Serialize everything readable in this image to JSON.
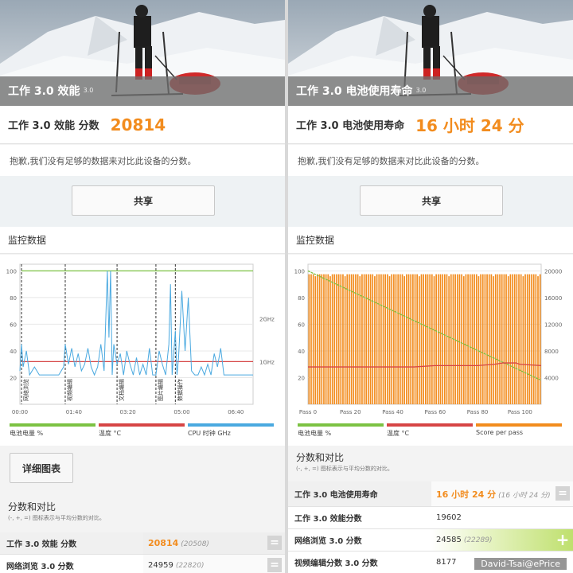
{
  "left": {
    "hero_title": "工作 3.0 效能",
    "hero_version": "3.0",
    "score_label": "工作 3.0 效能 分数",
    "score_value": "20814",
    "sorry_text": "抱歉,我们没有足够的数据来对比此设备的分数。",
    "share_label": "共享",
    "monitor_title": "监控数据",
    "detail_label": "详细图表",
    "compare_title": "分数和对比",
    "compare_note": "(-, +, =) 图标表示与平均分数的对比。",
    "legend": [
      {
        "label": "电池电量 %",
        "color": "#7cc243"
      },
      {
        "label": "温度 °C",
        "color": "#d64545"
      },
      {
        "label": "CPU 时钟 GHz",
        "color": "#4aa9e0"
      }
    ],
    "rows": [
      {
        "label": "工作 3.0 效能 分数",
        "value": "20814",
        "ref": "(20508)",
        "button": "="
      },
      {
        "label": "网络浏览 3.0 分数",
        "value": "24959",
        "ref": "(22820)",
        "button": "="
      }
    ]
  },
  "right": {
    "hero_title": "工作 3.0 电池使用寿命",
    "hero_version": "3.0",
    "score_label": "工作 3.0 电池使用寿命",
    "score_value": "16 小时 24 分",
    "sorry_text": "抱歉,我们没有足够的数据来对比此设备的分数。",
    "share_label": "共享",
    "monitor_title": "监控数据",
    "compare_title": "分数和对比",
    "compare_note": "(-, +, =) 图标表示与平均分数的对比。",
    "legend": [
      {
        "label": "电池电量 %",
        "color": "#7cc243"
      },
      {
        "label": "温度 °C",
        "color": "#d64545"
      },
      {
        "label": "Score per pass",
        "color": "#f28c1e"
      }
    ],
    "rows": [
      {
        "label": "工作 3.0 电池使用寿命",
        "value": "16 小时 24 分",
        "ref": "(16 小时 24 分)",
        "button": "="
      },
      {
        "label": "工作 3.0 效能分数",
        "value": "19602",
        "ref": "",
        "button": ""
      },
      {
        "label": "网络浏览 3.0 分数",
        "value": "24585",
        "ref": "(22289)",
        "button": "+"
      },
      {
        "label": "视频编辑分数 3.0 分数",
        "value": "8177",
        "ref": "",
        "button": ""
      }
    ]
  },
  "watermark": "David-Tsai@ePrice",
  "chart_data": [
    {
      "type": "line",
      "title": "",
      "x_ticks": [
        "00:00",
        "01:40",
        "03:20",
        "05:00",
        "06:40"
      ],
      "y_ticks": [
        20,
        40,
        60,
        80,
        100
      ],
      "y2_ticks": [
        "1GHz",
        "2GHz"
      ],
      "xlim": [
        0,
        7.2
      ],
      "ylim": [
        0,
        105
      ],
      "phase_labels": [
        "网络浏览",
        "视频编辑",
        "文档编辑",
        "图片编辑",
        "数据操作"
      ],
      "phase_starts": [
        0.05,
        1.4,
        3.0,
        4.2,
        4.8
      ],
      "series": [
        {
          "name": "电池电量 %",
          "x": [
            0.05,
            7.2
          ],
          "values": [
            100,
            100
          ]
        },
        {
          "name": "温度 °C",
          "x": [
            0.05,
            0.1,
            1.4,
            2.85,
            2.9,
            7.2
          ],
          "values": [
            32,
            32,
            32,
            32,
            32,
            32
          ]
        },
        {
          "name": "CPU 时钟 GHz",
          "x": [
            0.0,
            0.05,
            0.1,
            0.2,
            0.3,
            0.45,
            0.6,
            0.8,
            1.0,
            1.2,
            1.35,
            1.4,
            1.5,
            1.6,
            1.7,
            1.8,
            1.9,
            2.0,
            2.1,
            2.2,
            2.3,
            2.4,
            2.5,
            2.6,
            2.7,
            2.75,
            2.8,
            2.85,
            2.9,
            3.0,
            3.1,
            3.2,
            3.3,
            3.4,
            3.5,
            3.6,
            3.7,
            3.8,
            3.9,
            4.0,
            4.1,
            4.2,
            4.3,
            4.4,
            4.5,
            4.6,
            4.65,
            4.7,
            4.8,
            4.85,
            4.9,
            5.0,
            5.1,
            5.2,
            5.3,
            5.4,
            5.5,
            5.6,
            5.7,
            5.8,
            5.9,
            6.0,
            6.1,
            6.2,
            6.3,
            6.4,
            7.2
          ],
          "values": [
            25,
            45,
            28,
            40,
            22,
            28,
            22,
            22,
            22,
            22,
            28,
            45,
            30,
            42,
            28,
            38,
            25,
            30,
            42,
            28,
            22,
            28,
            45,
            25,
            100,
            50,
            100,
            22,
            45,
            30,
            38,
            22,
            40,
            30,
            22,
            35,
            22,
            30,
            22,
            42,
            22,
            22,
            40,
            30,
            22,
            45,
            90,
            22,
            55,
            22,
            35,
            85,
            40,
            80,
            25,
            22,
            22,
            28,
            22,
            30,
            22,
            38,
            28,
            42,
            22,
            22,
            22
          ]
        }
      ]
    },
    {
      "type": "bar",
      "title": "",
      "x_ticks": [
        "Pass 0",
        "Pass 20",
        "Pass 40",
        "Pass 60",
        "Pass 80",
        "Pass 100"
      ],
      "y_ticks": [
        20,
        40,
        60,
        80,
        100
      ],
      "y2_ticks": [
        4000,
        8000,
        12000,
        16000,
        20000
      ],
      "xlim": [
        0,
        110
      ],
      "ylim": [
        0,
        105
      ],
      "y2lim": [
        0,
        21000
      ],
      "series": [
        {
          "name": "Score per pass",
          "value_each_pass": 19500,
          "passes": 110
        },
        {
          "name": "电池电量 %",
          "x": [
            0,
            110
          ],
          "values": [
            100,
            18
          ]
        },
        {
          "name": "温度 °C",
          "x": [
            0,
            20,
            40,
            50,
            60,
            80,
            88,
            92,
            98,
            100,
            110
          ],
          "values": [
            28,
            28,
            28,
            28,
            29,
            29,
            30,
            31,
            31,
            30,
            29
          ]
        }
      ]
    }
  ]
}
